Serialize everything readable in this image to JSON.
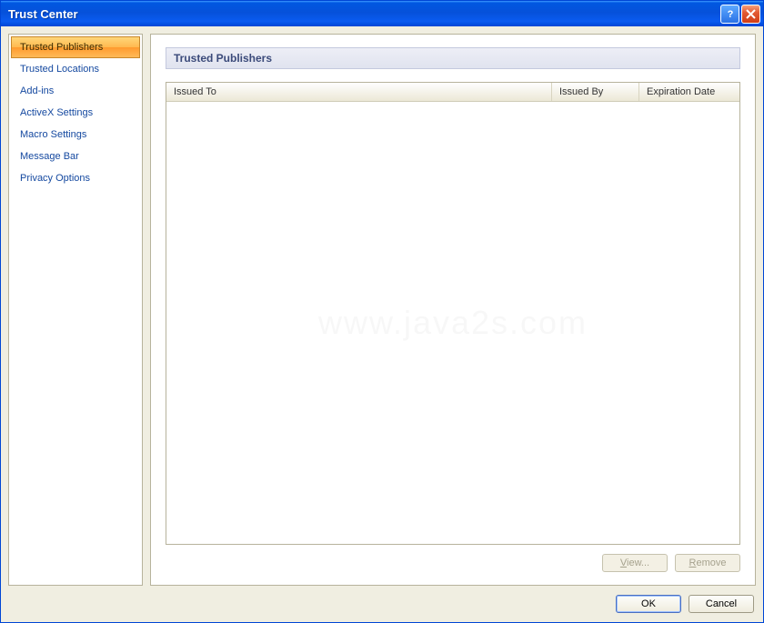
{
  "title": "Trust Center",
  "sidebar": {
    "items": [
      {
        "label": "Trusted Publishers",
        "selected": true
      },
      {
        "label": "Trusted Locations",
        "selected": false
      },
      {
        "label": "Add-ins",
        "selected": false
      },
      {
        "label": "ActiveX Settings",
        "selected": false
      },
      {
        "label": "Macro Settings",
        "selected": false
      },
      {
        "label": "Message Bar",
        "selected": false
      },
      {
        "label": "Privacy Options",
        "selected": false
      }
    ]
  },
  "section": {
    "heading": "Trusted Publishers"
  },
  "columns": {
    "issued_to": "Issued To",
    "issued_by": "Issued By",
    "expiration": "Expiration Date"
  },
  "rows": [],
  "buttons": {
    "view": "View...",
    "remove": "Remove",
    "ok": "OK",
    "cancel": "Cancel"
  },
  "watermark": "www.java2s.com"
}
